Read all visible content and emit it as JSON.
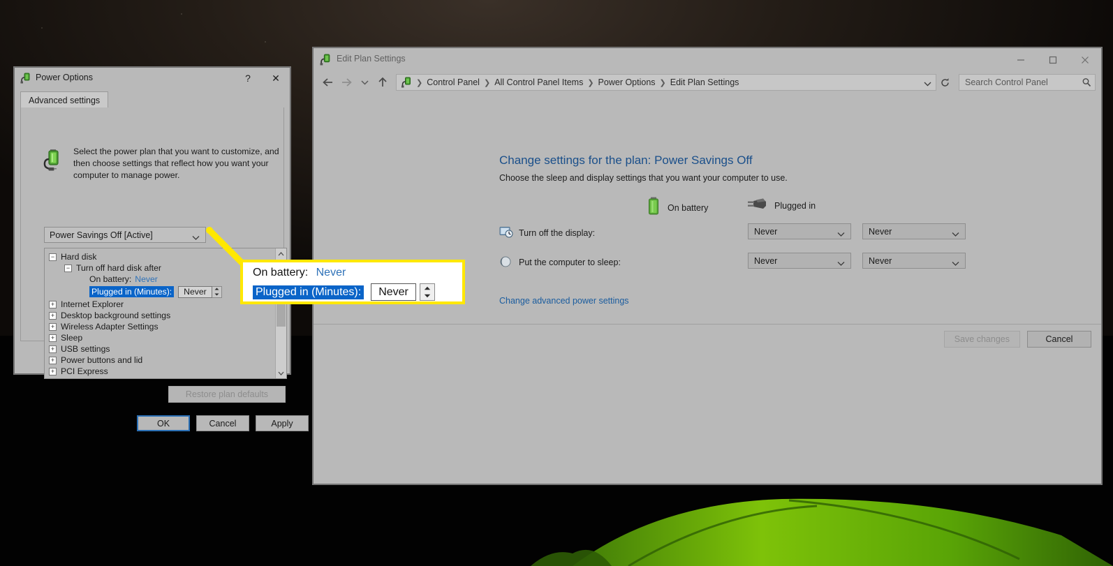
{
  "desktop": {
    "wallpaper_description": "night sky over mountains with a green lit tent"
  },
  "explorer": {
    "title": "Edit Plan Settings",
    "window_icon": "power-plug-battery-icon",
    "controls": {
      "minimize": "minimize-icon",
      "maximize": "maximize-icon",
      "close": "close-icon"
    },
    "nav": {
      "back": "back-arrow-icon",
      "forward": "forward-arrow-icon",
      "recent": "chevron-down-icon",
      "up": "up-arrow-icon",
      "refresh": "refresh-icon"
    },
    "breadcrumb": [
      "Control Panel",
      "All Control Panel Items",
      "Power Options",
      "Edit Plan Settings"
    ],
    "search": {
      "placeholder": "Search Control Panel",
      "icon": "search-icon"
    },
    "page_title": "Change settings for the plan: Power Savings Off",
    "page_subtitle": "Choose the sleep and display settings that you want your computer to use.",
    "columns": [
      {
        "label": "On battery",
        "icon": "battery-icon"
      },
      {
        "label": "Plugged in",
        "icon": "power-plug-icon"
      }
    ],
    "settings": [
      {
        "icon": "display-clock-icon",
        "label": "Turn off the display:",
        "on_battery": "Never",
        "plugged_in": "Never"
      },
      {
        "icon": "sleep-moon-icon",
        "label": "Put the computer to sleep:",
        "on_battery": "Never",
        "plugged_in": "Never"
      }
    ],
    "advanced_link": "Change advanced power settings",
    "buttons": {
      "save": "Save changes",
      "cancel": "Cancel"
    }
  },
  "power_options": {
    "title": "Power Options",
    "window_icon": "power-plug-battery-icon",
    "help_label": "?",
    "close_label": "✕",
    "tab": "Advanced settings",
    "description": "Select the power plan that you want to customize, and then choose settings that reflect how you want your computer to manage power.",
    "description_icon": "battery-plug-icon",
    "plan_selected": "Power Savings Off [Active]",
    "tree": [
      {
        "level": 0,
        "expander": "−",
        "label": "Hard disk"
      },
      {
        "level": 1,
        "expander": "−",
        "label": "Turn off hard disk after"
      },
      {
        "level": 2,
        "expander": "",
        "label": "On battery:",
        "value": "Never"
      },
      {
        "level": 2,
        "expander": "",
        "label": "Plugged in (Minutes):",
        "value": "Never",
        "selected": true
      },
      {
        "level": 0,
        "expander": "+",
        "label": "Internet Explorer"
      },
      {
        "level": 0,
        "expander": "+",
        "label": "Desktop background settings"
      },
      {
        "level": 0,
        "expander": "+",
        "label": "Wireless Adapter Settings"
      },
      {
        "level": 0,
        "expander": "+",
        "label": "Sleep"
      },
      {
        "level": 0,
        "expander": "+",
        "label": "USB settings"
      },
      {
        "level": 0,
        "expander": "+",
        "label": "Power buttons and lid"
      },
      {
        "level": 0,
        "expander": "+",
        "label": "PCI Express"
      }
    ],
    "restore_defaults": "Restore plan defaults",
    "buttons": {
      "ok": "OK",
      "cancel": "Cancel",
      "apply": "Apply"
    }
  },
  "callout": {
    "border_color": "#ffe800",
    "on_battery_label": "On battery:",
    "on_battery_value": "Never",
    "plugged_in_label": "Plugged in (Minutes):",
    "plugged_in_value": "Never",
    "highlight_color": "#0a64c8"
  }
}
